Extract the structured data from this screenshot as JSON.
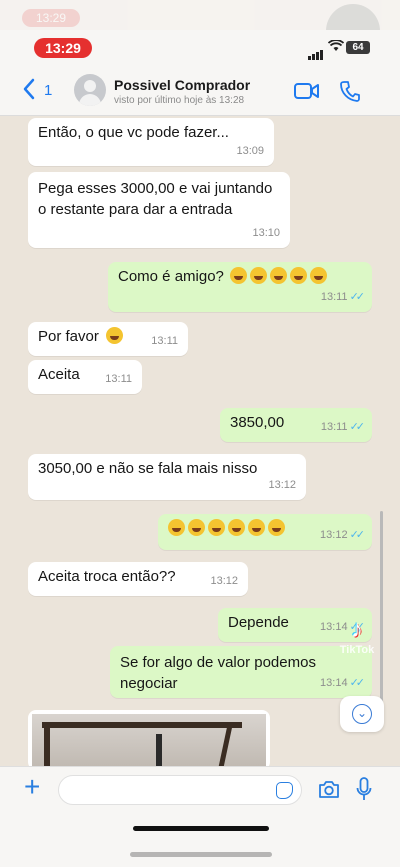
{
  "status": {
    "time": "13:29",
    "ghost_time": "13:29",
    "battery": "64"
  },
  "header": {
    "back_count": "1",
    "contact_name": "Possivel Comprador",
    "last_seen": "visto por último hoje às 13:28"
  },
  "messages": [
    {
      "dir": "in",
      "text": "Então, o que vc pode fazer...",
      "time": "13:09"
    },
    {
      "dir": "in",
      "text": "Pega esses 3000,00 e vai juntando o restante para dar a entrada",
      "time": "13:10"
    },
    {
      "dir": "out",
      "text": "Como é amigo?",
      "emoji_count": 5,
      "time": "13:11"
    },
    {
      "dir": "in",
      "text": "Por favor",
      "emoji_count": 1,
      "time": "13:11"
    },
    {
      "dir": "in",
      "text": "Aceita",
      "time": "13:11"
    },
    {
      "dir": "out",
      "text": "3850,00",
      "time": "13:11"
    },
    {
      "dir": "in",
      "text": "3050,00 e não se fala mais nisso",
      "time": "13:12"
    },
    {
      "dir": "out",
      "text": "",
      "emoji_count": 6,
      "time": "13:12"
    },
    {
      "dir": "in",
      "text": "Aceita troca então??",
      "time": "13:12"
    },
    {
      "dir": "out",
      "text": "Depende",
      "time": "13:14"
    },
    {
      "dir": "out",
      "text": "Se for algo de valor podemos negociar",
      "time": "13:14"
    }
  ],
  "watermark": {
    "brand": "TikTok"
  },
  "colors": {
    "accent": "#1f7aef",
    "outgoing_bubble": "#dcf8c6",
    "incoming_bubble": "#ffffff",
    "chat_bg": "#ebe4da",
    "read_ticks": "#4fb6ec",
    "time_pill": "#e5302f"
  },
  "icons": [
    "back-chevron-icon",
    "video-call-icon",
    "phone-call-icon",
    "plus-icon",
    "sticker-icon",
    "camera-icon",
    "microphone-icon",
    "scroll-down-icon"
  ]
}
